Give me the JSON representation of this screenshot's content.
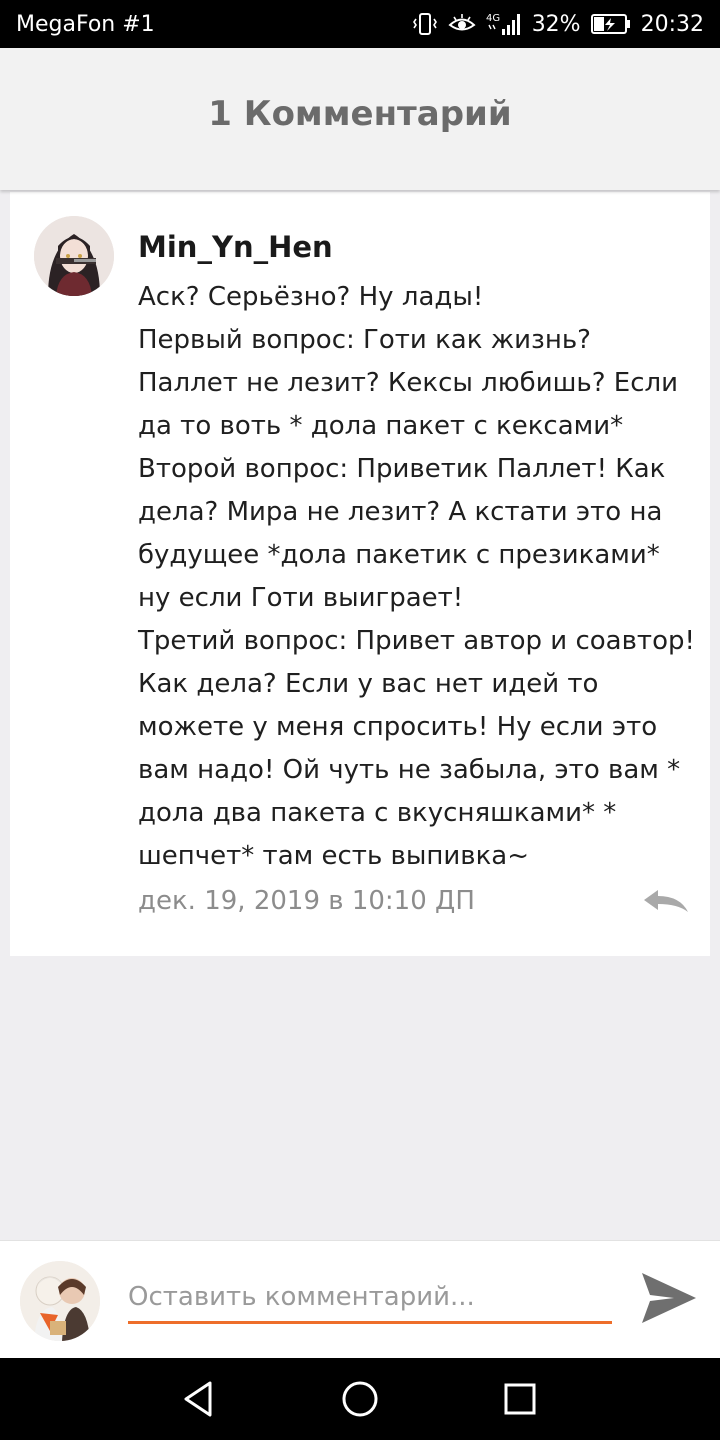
{
  "status_bar": {
    "carrier": "MegaFon #1",
    "network": "4G",
    "battery": "32%",
    "time": "20:32"
  },
  "header": {
    "title": "1 Комментарий"
  },
  "comment": {
    "author": "Min_Yn_Hen",
    "lines": [
      "Аск? Серьёзно? Ну лады!",
      "Первый вопрос: Готи как жизнь? Паллет не лезит? Кексы любишь? Если да то воть * дола пакет с кексами*",
      "Второй вопрос: Приветик Паллет! Как дела? Мира не лезит? А кстати это на будущее *дола пакетик с презиками* ну если Готи выиграет!",
      "Третий вопрос: Привет автор и соавтор! Как дела? Если у вас нет идей то можете у меня спросить! Ну если это вам надо! Ой чуть не забыла, это вам * дола два пакета с вкусняшками* * шепчет* там есть выпивка~"
    ],
    "timestamp": "дек. 19, 2019 в 10:10 ДП"
  },
  "input_bar": {
    "placeholder": "Оставить комментарий...",
    "value": ""
  },
  "icons": {
    "vibrate": "vibrate-icon",
    "eye": "eye-comfort-icon",
    "signal": "signal-icon",
    "battery": "battery-charging-icon",
    "reply": "reply-icon",
    "send": "send-icon",
    "back": "back-icon",
    "home": "home-icon",
    "recents": "recents-icon"
  },
  "colors": {
    "accent": "#ee6e2a",
    "background": "#efeef1"
  }
}
